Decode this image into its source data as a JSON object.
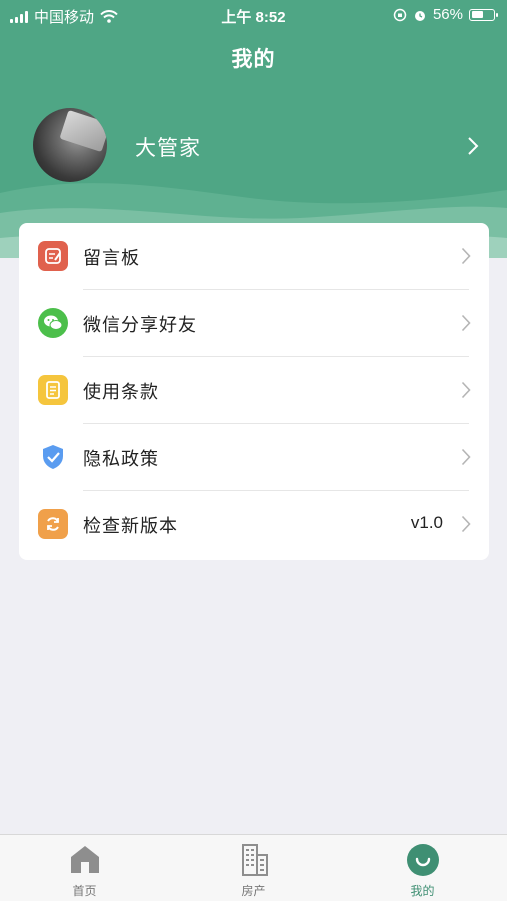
{
  "status_bar": {
    "carrier": "中国移动",
    "time": "上午 8:52",
    "battery": "56%",
    "battery_level": 0.56
  },
  "header": {
    "title": "我的",
    "color": "#4fa685"
  },
  "profile": {
    "name": "大管家"
  },
  "menu": [
    {
      "label": "留言板",
      "icon": "message-board-icon",
      "color": "#e0614d"
    },
    {
      "label": "微信分享好友",
      "icon": "wechat-icon",
      "color": "#4cbf4b"
    },
    {
      "label": "使用条款",
      "icon": "terms-document-icon",
      "color": "#f5c53d"
    },
    {
      "label": "隐私政策",
      "icon": "shield-check-icon",
      "color": "#5a9cf0"
    },
    {
      "label": "检查新版本",
      "icon": "refresh-icon",
      "color": "#f0a04a",
      "value": "v1.0"
    }
  ],
  "tabbar": {
    "items": [
      {
        "label": "首页",
        "icon": "home-icon",
        "active": false
      },
      {
        "label": "房产",
        "icon": "building-icon",
        "active": false
      },
      {
        "label": "我的",
        "icon": "smile-icon",
        "active": true
      }
    ],
    "active_color": "#3f8f73"
  }
}
